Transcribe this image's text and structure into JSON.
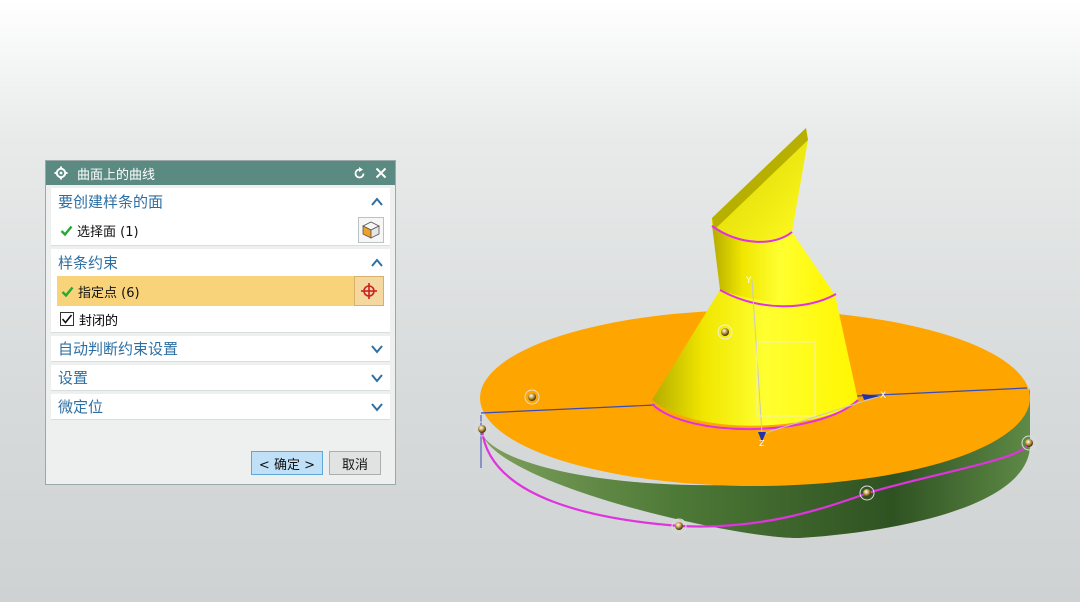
{
  "dialog": {
    "title": "曲面上的曲线",
    "icons": {
      "settings": "gear-icon",
      "reset": "reset-icon",
      "close": "close-icon"
    },
    "sections": {
      "faces": {
        "title": "要创建样条的面",
        "expanded": true,
        "select_label": "选择面 (1)",
        "select_icon": "cube-face-icon"
      },
      "constraints": {
        "title": "样条约束",
        "expanded": true,
        "point_label": "指定点 (6)",
        "point_icon": "crosshair-icon",
        "closed_label": "封闭的",
        "closed_checked": true
      },
      "auto": {
        "title": "自动判断约束设置",
        "expanded": false
      },
      "settings": {
        "title": "设置",
        "expanded": false
      },
      "preview": {
        "title": "微定位",
        "expanded": false
      }
    },
    "buttons": {
      "ok": "< 确定 >",
      "cancel": "取消"
    }
  },
  "model": {
    "colors": {
      "base_top": "#FFA500",
      "base_side": "#4E7A37",
      "cone": "#FFF200",
      "spline": "#E033E0",
      "edge": "#3040C0"
    },
    "axis_labels": {
      "y": "Y",
      "x": "X",
      "z": "Z"
    }
  }
}
